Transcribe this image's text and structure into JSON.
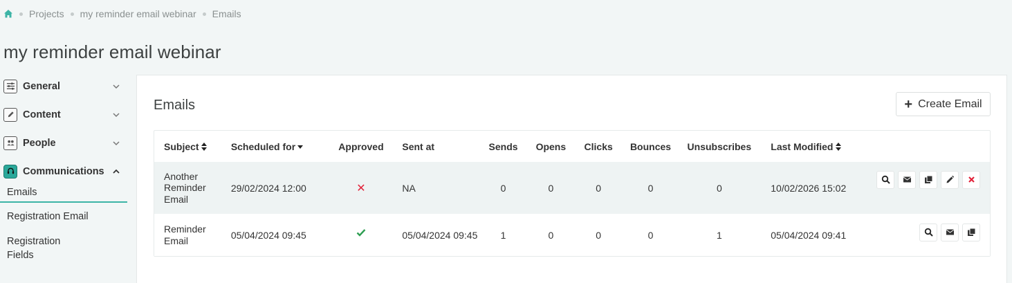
{
  "breadcrumb": {
    "home_icon": "home-icon",
    "items": [
      "Projects",
      "my reminder email webinar",
      "Emails"
    ]
  },
  "page": {
    "title": "my reminder email webinar"
  },
  "sidebar": {
    "sections": [
      {
        "label": "General",
        "icon": "sliders-icon",
        "expanded": false
      },
      {
        "label": "Content",
        "icon": "pencil-square-icon",
        "expanded": false
      },
      {
        "label": "People",
        "icon": "people-icon",
        "expanded": false
      },
      {
        "label": "Communications",
        "icon": "communications-icon",
        "expanded": true
      }
    ],
    "sub_items": [
      "Emails",
      "Registration Email",
      "Registration Fields"
    ],
    "active_sub": "Emails"
  },
  "main": {
    "title": "Emails",
    "create_button": "Create Email",
    "table": {
      "headers": [
        "Subject",
        "Scheduled for",
        "Approved",
        "Sent at",
        "Sends",
        "Opens",
        "Clicks",
        "Bounces",
        "Unsubscribes",
        "Last Modified"
      ],
      "rows": [
        {
          "subject": "Another Reminder Email",
          "scheduled_for": "29/02/2024 12:00",
          "approved": false,
          "sent_at": "NA",
          "sends": "0",
          "opens": "0",
          "clicks": "0",
          "bounces": "0",
          "unsubscribes": "0",
          "last_modified": "10/02/2026 15:02",
          "actions": [
            "search-icon",
            "envelope-icon",
            "copy-icon",
            "pencil-icon",
            "delete-icon"
          ]
        },
        {
          "subject": "Reminder Email",
          "scheduled_for": "05/04/2024 09:45",
          "approved": true,
          "sent_at": "05/04/2024 09:45",
          "sends": "1",
          "opens": "0",
          "clicks": "0",
          "bounces": "0",
          "unsubscribes": "1",
          "last_modified": "05/04/2024 09:41",
          "actions": [
            "search-icon",
            "envelope-icon",
            "copy-icon"
          ]
        }
      ]
    }
  },
  "colors": {
    "accent": "#3cb4a6",
    "danger": "#e2233a",
    "success": "#2e9e52",
    "background": "#f2f6f6"
  }
}
